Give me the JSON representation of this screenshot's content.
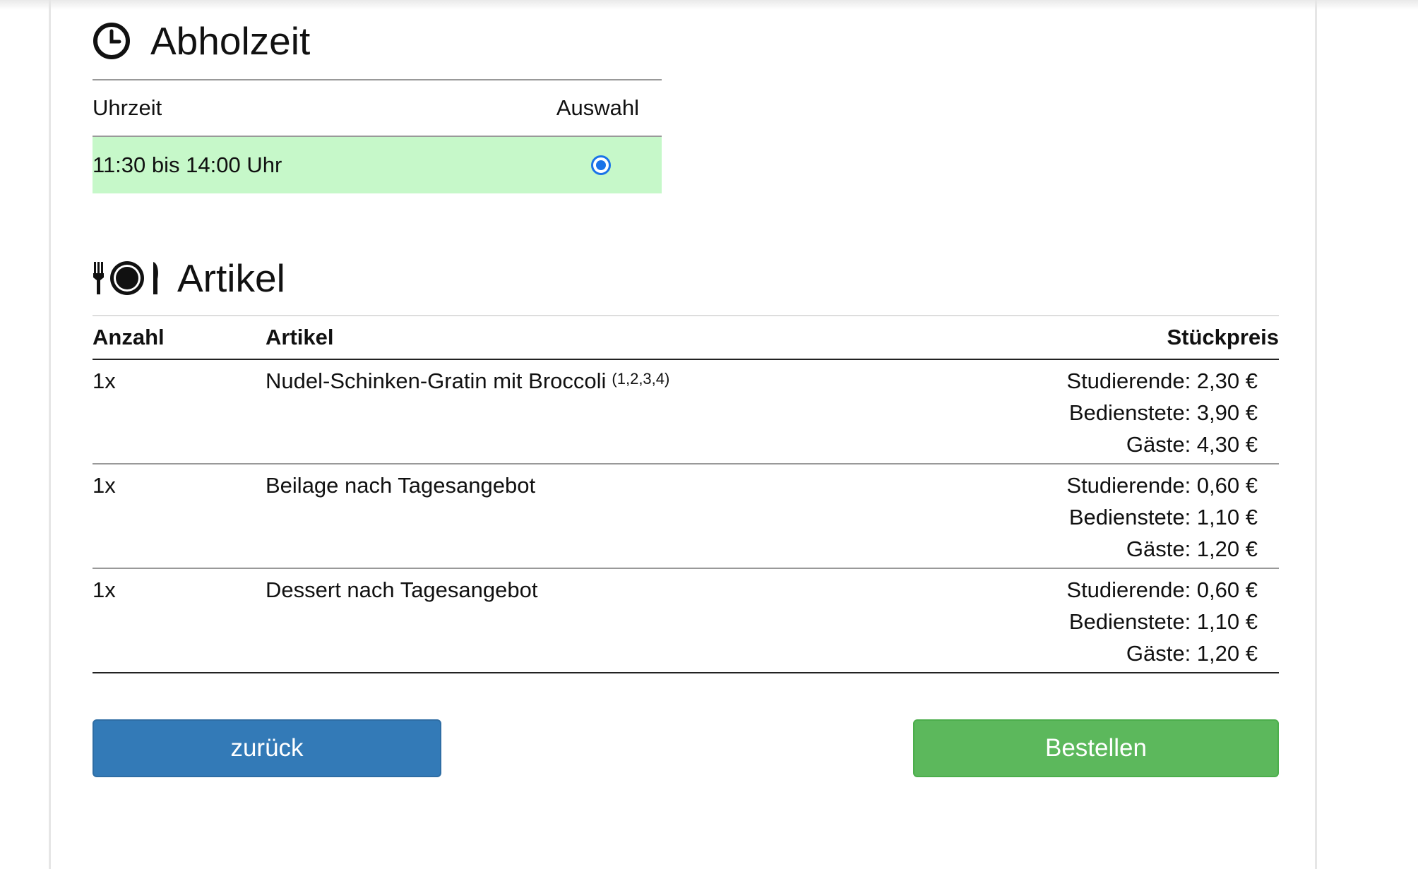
{
  "abholzeit": {
    "title": "Abholzeit",
    "icon": "clock-icon",
    "columns": {
      "time": "Uhrzeit",
      "select": "Auswahl"
    },
    "slots": [
      {
        "time": "11:30 bis 14:00 Uhr",
        "selected": true
      }
    ]
  },
  "artikel": {
    "title": "Artikel",
    "icon": "cutlery-plate-icon",
    "columns": {
      "qty": "Anzahl",
      "name": "Artikel",
      "price": "Stückpreis"
    },
    "rows": [
      {
        "qty": "1x",
        "name": "Nudel-Schinken-Gratin mit Broccoli",
        "additives": "(1,2,3,4)",
        "prices": [
          "Studierende: 2,30 €",
          "Bedienstete: 3,90 €",
          "Gäste: 4,30 €"
        ]
      },
      {
        "qty": "1x",
        "name": "Beilage nach Tagesangebot",
        "additives": "",
        "prices": [
          "Studierende: 0,60 €",
          "Bedienstete: 1,10 €",
          "Gäste: 1,20 €"
        ]
      },
      {
        "qty": "1x",
        "name": "Dessert nach Tagesangebot",
        "additives": "",
        "prices": [
          "Studierende: 0,60 €",
          "Bedienstete: 1,10 €",
          "Gäste: 1,20 €"
        ]
      }
    ]
  },
  "buttons": {
    "back": "zurück",
    "order": "Bestellen"
  },
  "colors": {
    "selected_row": "#c6f8c9",
    "back_button": "#337ab7",
    "order_button": "#5cb85c",
    "radio": "#1a73e8"
  }
}
